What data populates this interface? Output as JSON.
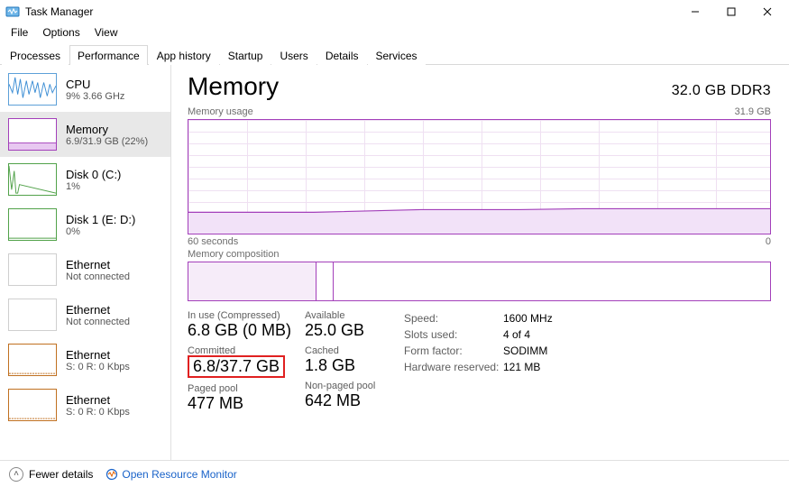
{
  "window": {
    "title": "Task Manager"
  },
  "menu": {
    "file": "File",
    "options": "Options",
    "view": "View"
  },
  "tabs": [
    {
      "label": "Processes"
    },
    {
      "label": "Performance"
    },
    {
      "label": "App history"
    },
    {
      "label": "Startup"
    },
    {
      "label": "Users"
    },
    {
      "label": "Details"
    },
    {
      "label": "Services"
    }
  ],
  "sidebar": [
    {
      "title": "CPU",
      "sub": "9%  3.66 GHz"
    },
    {
      "title": "Memory",
      "sub": "6.9/31.9 GB (22%)"
    },
    {
      "title": "Disk 0 (C:)",
      "sub": "1%"
    },
    {
      "title": "Disk 1 (E: D:)",
      "sub": "0%"
    },
    {
      "title": "Ethernet",
      "sub": "Not connected"
    },
    {
      "title": "Ethernet",
      "sub": "Not connected"
    },
    {
      "title": "Ethernet",
      "sub": "S: 0  R: 0 Kbps"
    },
    {
      "title": "Ethernet",
      "sub": "S: 0  R: 0 Kbps"
    }
  ],
  "main": {
    "heading": "Memory",
    "heading_right": "32.0 GB DDR3",
    "usage_label": "Memory usage",
    "usage_max": "31.9 GB",
    "usage_x_left": "60 seconds",
    "usage_x_right": "0",
    "composition_label": "Memory composition",
    "composition_segments_pct": [
      22,
      3,
      75
    ]
  },
  "chart_data": {
    "type": "line",
    "title": "Memory usage",
    "ylabel": "GB",
    "ylim": [
      0,
      31.9
    ],
    "x_seconds": [
      60,
      55,
      50,
      45,
      40,
      35,
      30,
      25,
      20,
      15,
      10,
      5,
      0
    ],
    "values_gb": [
      6.6,
      6.6,
      6.6,
      6.6,
      6.7,
      6.8,
      6.9,
      6.9,
      6.9,
      6.9,
      6.9,
      6.9,
      6.9
    ]
  },
  "stats": {
    "inuse_label": "In use (Compressed)",
    "inuse_value": "6.8 GB (0 MB)",
    "available_label": "Available",
    "available_value": "25.0 GB",
    "committed_label": "Committed",
    "committed_value": "6.8/37.7 GB",
    "cached_label": "Cached",
    "cached_value": "1.8 GB",
    "paged_label": "Paged pool",
    "paged_value": "477 MB",
    "nonpaged_label": "Non-paged pool",
    "nonpaged_value": "642 MB"
  },
  "spec": {
    "speed_label": "Speed:",
    "speed_value": "1600 MHz",
    "slots_label": "Slots used:",
    "slots_value": "4 of 4",
    "form_label": "Form factor:",
    "form_value": "SODIMM",
    "hwres_label": "Hardware reserved:",
    "hwres_value": "121 MB"
  },
  "footer": {
    "fewer": "Fewer details",
    "resmon": "Open Resource Monitor"
  }
}
